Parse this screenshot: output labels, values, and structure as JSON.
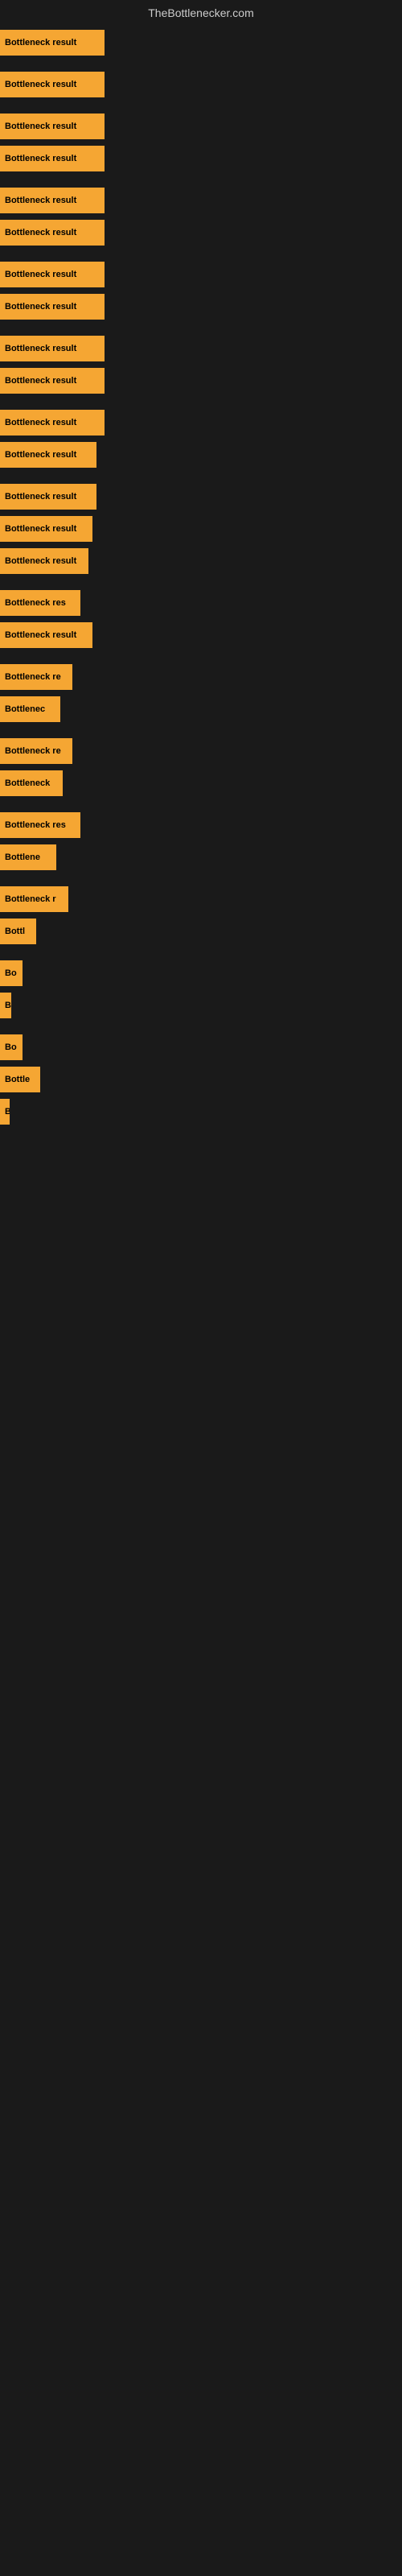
{
  "header": {
    "title": "TheBottlenecker.com"
  },
  "bars": [
    {
      "id": 1,
      "label": "Bottleneck result",
      "width": 130
    },
    {
      "id": 2,
      "label": "Bottleneck result",
      "width": 130,
      "spacer_before": true
    },
    {
      "id": 3,
      "label": "Bottleneck result",
      "width": 130,
      "spacer_before": true
    },
    {
      "id": 4,
      "label": "Bottleneck result",
      "width": 130
    },
    {
      "id": 5,
      "label": "Bottleneck result",
      "width": 130,
      "spacer_before": true
    },
    {
      "id": 6,
      "label": "Bottleneck result",
      "width": 130
    },
    {
      "id": 7,
      "label": "Bottleneck result",
      "width": 130,
      "spacer_before": true
    },
    {
      "id": 8,
      "label": "Bottleneck result",
      "width": 130
    },
    {
      "id": 9,
      "label": "Bottleneck result",
      "width": 130,
      "spacer_before": true
    },
    {
      "id": 10,
      "label": "Bottleneck result",
      "width": 130
    },
    {
      "id": 11,
      "label": "Bottleneck result",
      "width": 130,
      "spacer_before": true
    },
    {
      "id": 12,
      "label": "Bottleneck result",
      "width": 120
    },
    {
      "id": 13,
      "label": "Bottleneck result",
      "width": 120,
      "spacer_before": true
    },
    {
      "id": 14,
      "label": "Bottleneck result",
      "width": 115
    },
    {
      "id": 15,
      "label": "Bottleneck result",
      "width": 110
    },
    {
      "id": 16,
      "label": "Bottleneck res",
      "width": 100,
      "spacer_before": true
    },
    {
      "id": 17,
      "label": "Bottleneck result",
      "width": 115
    },
    {
      "id": 18,
      "label": "Bottleneck re",
      "width": 90,
      "spacer_before": true
    },
    {
      "id": 19,
      "label": "Bottlenec",
      "width": 75
    },
    {
      "id": 20,
      "label": "Bottleneck re",
      "width": 90,
      "spacer_before": true
    },
    {
      "id": 21,
      "label": "Bottleneck",
      "width": 78
    },
    {
      "id": 22,
      "label": "Bottleneck res",
      "width": 100,
      "spacer_before": true
    },
    {
      "id": 23,
      "label": "Bottlene",
      "width": 70
    },
    {
      "id": 24,
      "label": "Bottleneck r",
      "width": 85,
      "spacer_before": true
    },
    {
      "id": 25,
      "label": "Bottl",
      "width": 45
    },
    {
      "id": 26,
      "label": "Bo",
      "width": 28,
      "spacer_before": true
    },
    {
      "id": 27,
      "label": "B",
      "width": 14
    },
    {
      "id": 28,
      "label": "Bo",
      "width": 28,
      "spacer_before": true
    },
    {
      "id": 29,
      "label": "Bottle",
      "width": 50
    },
    {
      "id": 30,
      "label": "B",
      "width": 12
    }
  ]
}
